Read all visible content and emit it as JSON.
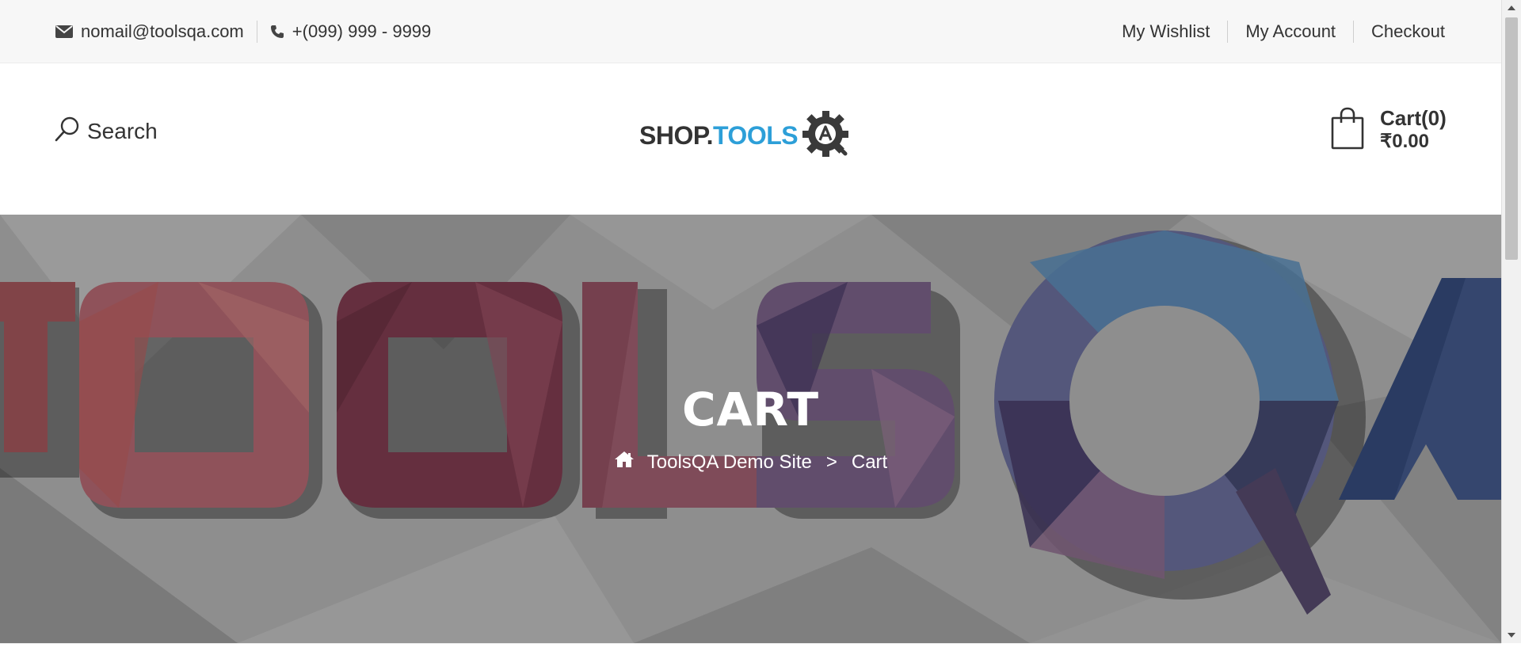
{
  "topbar": {
    "email": "nomail@toolsqa.com",
    "phone": "+(099) 999 - 9999",
    "links": [
      "My Wishlist",
      "My Account",
      "Checkout"
    ]
  },
  "header": {
    "search_label": "Search",
    "logo_shop": "SHOP.",
    "logo_tools": "TOOLS",
    "cart_count": "Cart(0)",
    "cart_total": "₹0.00"
  },
  "banner": {
    "title": "CART",
    "breadcrumb": [
      "ToolsQA Demo Site",
      ">",
      "Cart"
    ]
  },
  "colors": {
    "accent": "#2d9fd8",
    "topbar_bg": "#f7f7f7",
    "banner_bg": "#9a9a9a"
  },
  "icons": [
    "envelope-icon",
    "phone-icon",
    "search-icon",
    "gear-logo-icon",
    "shopping-bag-icon",
    "home-icon"
  ]
}
